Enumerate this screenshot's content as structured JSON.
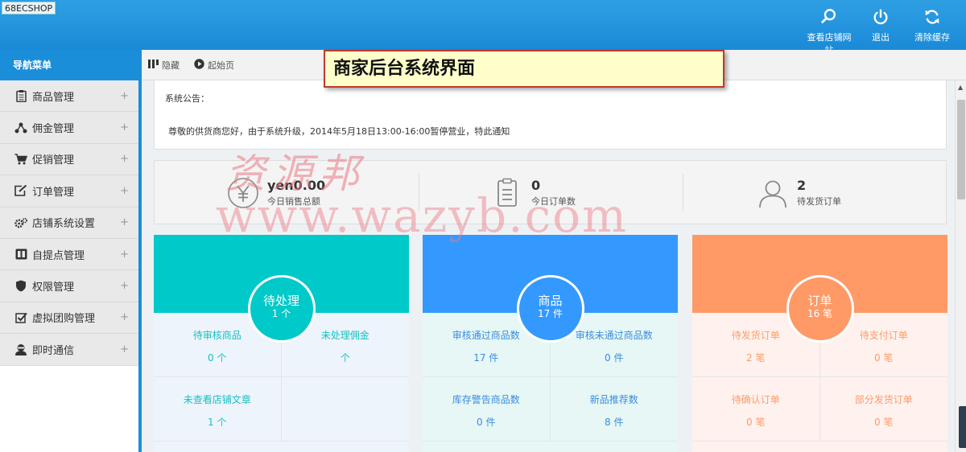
{
  "header": {
    "logo_alt": "68ECSHOP",
    "actions": [
      {
        "label": "查看店铺网站",
        "icon": "search-icon"
      },
      {
        "label": "退出",
        "icon": "power-icon"
      },
      {
        "label": "清除缓存",
        "icon": "refresh-icon"
      }
    ]
  },
  "sidebar": {
    "title": "导航菜单",
    "items": [
      {
        "label": "商品管理",
        "icon": "clipboard-icon"
      },
      {
        "label": "佣金管理",
        "icon": "share-icon"
      },
      {
        "label": "促销管理",
        "icon": "cart-icon"
      },
      {
        "label": "订单管理",
        "icon": "edit-icon"
      },
      {
        "label": "店铺系统设置",
        "icon": "gears-icon"
      },
      {
        "label": "自提点管理",
        "icon": "columns-icon"
      },
      {
        "label": "权限管理",
        "icon": "shield-icon"
      },
      {
        "label": "虚拟团购管理",
        "icon": "checkbox-icon"
      },
      {
        "label": "即时通信",
        "icon": "user-chat-icon"
      }
    ]
  },
  "toolbar": {
    "hide_label": "隐藏",
    "home_label": "起始页"
  },
  "callout": {
    "text": "商家后台系统界面"
  },
  "watermark": {
    "line1": "资源邦",
    "line2": "www.wazyb.com"
  },
  "notice": {
    "title": "系统公告：",
    "text": "尊敬的供货商您好，由于系统升级，2014年5月18日13:00-16:00暂停营业，特此通知"
  },
  "stats": [
    {
      "value": "yen0.00",
      "label": "今日销售总额",
      "icon": "yen-icon"
    },
    {
      "value": "0",
      "label": "今日订单数",
      "icon": "clipboard-list-icon"
    },
    {
      "value": "2",
      "label": "待发货订单",
      "icon": "user-icon"
    }
  ],
  "cards": [
    {
      "title": "待处理",
      "count": "1 个",
      "cells": [
        {
          "label": "待审核商品",
          "value": "0 个"
        },
        {
          "label": "未处理佣金",
          "value": "个"
        },
        {
          "label": "未查看店铺文章",
          "value": "1 个"
        },
        {
          "label": "",
          "value": ""
        }
      ]
    },
    {
      "title": "商品",
      "count": "17 件",
      "cells": [
        {
          "label": "审核通过商品数",
          "value": "17 件"
        },
        {
          "label": "审核未通过商品数",
          "value": "0 件"
        },
        {
          "label": "库存警告商品数",
          "value": "0 件"
        },
        {
          "label": "新品推荐数",
          "value": "8 件"
        }
      ]
    },
    {
      "title": "订单",
      "count": "16 笔",
      "cells": [
        {
          "label": "待发货订单",
          "value": "2 笔"
        },
        {
          "label": "待支付订单",
          "value": "0 笔"
        },
        {
          "label": "待确认订单",
          "value": "0 笔"
        },
        {
          "label": "部分发货订单",
          "value": "0 笔"
        }
      ]
    }
  ],
  "colors": {
    "header": "#1b8ed9",
    "card_teal": "#00c9c9",
    "card_blue": "#3399ff",
    "card_orange": "#ff9966",
    "callout_border": "#c0392b"
  }
}
